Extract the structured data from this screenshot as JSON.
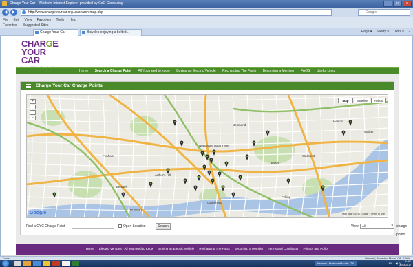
{
  "window": {
    "title": "Charge Your Car - Windows Internet Explorer provided by CoG Computing",
    "minimize": "–",
    "maximize": "□",
    "close": "x"
  },
  "browser": {
    "back": "◀",
    "forward": "▶",
    "url": "http://www.chargeyourcar.org.uk/search-map.php",
    "search_placeholder": "Google",
    "menu": [
      "File",
      "Edit",
      "View",
      "Favorites",
      "Tools",
      "Help"
    ],
    "links": [
      "Favorites",
      "Suggested Sites"
    ],
    "tabs": [
      "Charge Your Car",
      "Bicycles enjoying a belted..."
    ],
    "commands": [
      "Page ▾",
      "Safety ▾",
      "Tools ▾",
      "?"
    ]
  },
  "site": {
    "logo_line1_a": "CHAR",
    "logo_line1_b": "G",
    "logo_line1_c": "E",
    "logo_line2": "YOUR CAR",
    "logo_tagline": "Home · Public · Membership",
    "nav": [
      "Home",
      "Search a Charge Point",
      "All You need to know",
      "Buying an Electric Vehicle",
      "Recharging The Facts",
      "Becoming a Member",
      "FAQS",
      "Useful Links"
    ],
    "nav_selected": 1
  },
  "panel": {
    "title": "Charge Your Car Charge Points"
  },
  "map": {
    "type_buttons": [
      "Map",
      "Satellite",
      "Hybrid"
    ],
    "type_selected": 0,
    "zoom_in": "+",
    "zoom_out": "−",
    "google": "Google",
    "copyright": "Map data ©2012 Google · Terms of Use",
    "places": [
      "Newcastle upon Tyne",
      "Gateshead",
      "Arthur's Hill",
      "Heaton",
      "Walker",
      "Byker",
      "Fenham",
      "Jesmond",
      "Benwell",
      "Dunston",
      "Felling",
      "Wallsend"
    ],
    "colors": {
      "land": "#ecebe3",
      "park": "#c8dfb2",
      "water": "#a9c4e4",
      "road_major": "#f0b445",
      "road_trunk": "#8fbf67",
      "road_minor": "#ffffff",
      "marker": "#2f2f2f"
    }
  },
  "find": {
    "label": "Find a CYC Charge Point",
    "input_placeholder": "",
    "open_location": "Open Location",
    "search_button": "Search",
    "view_label": "View",
    "view_value": "All",
    "charge_points_label": "charge points"
  },
  "footer": {
    "links": [
      "Home",
      "Electric Vehicles - All You need to Know",
      "Buying an Electric Vehicle",
      "Recharging The Facts",
      "Becoming a Member",
      "Terms and Conditions",
      "Privacy and Policy"
    ]
  },
  "status": {
    "left": "Done",
    "zone": "Internet | Protected Mode: Off",
    "zoom": "100%"
  },
  "taskbar": {
    "active_window": "Internet | Protected Mode: Off",
    "tray": "EN ▴ ◀ ⊙",
    "time": "09:22",
    "date": "06/03/2012"
  }
}
